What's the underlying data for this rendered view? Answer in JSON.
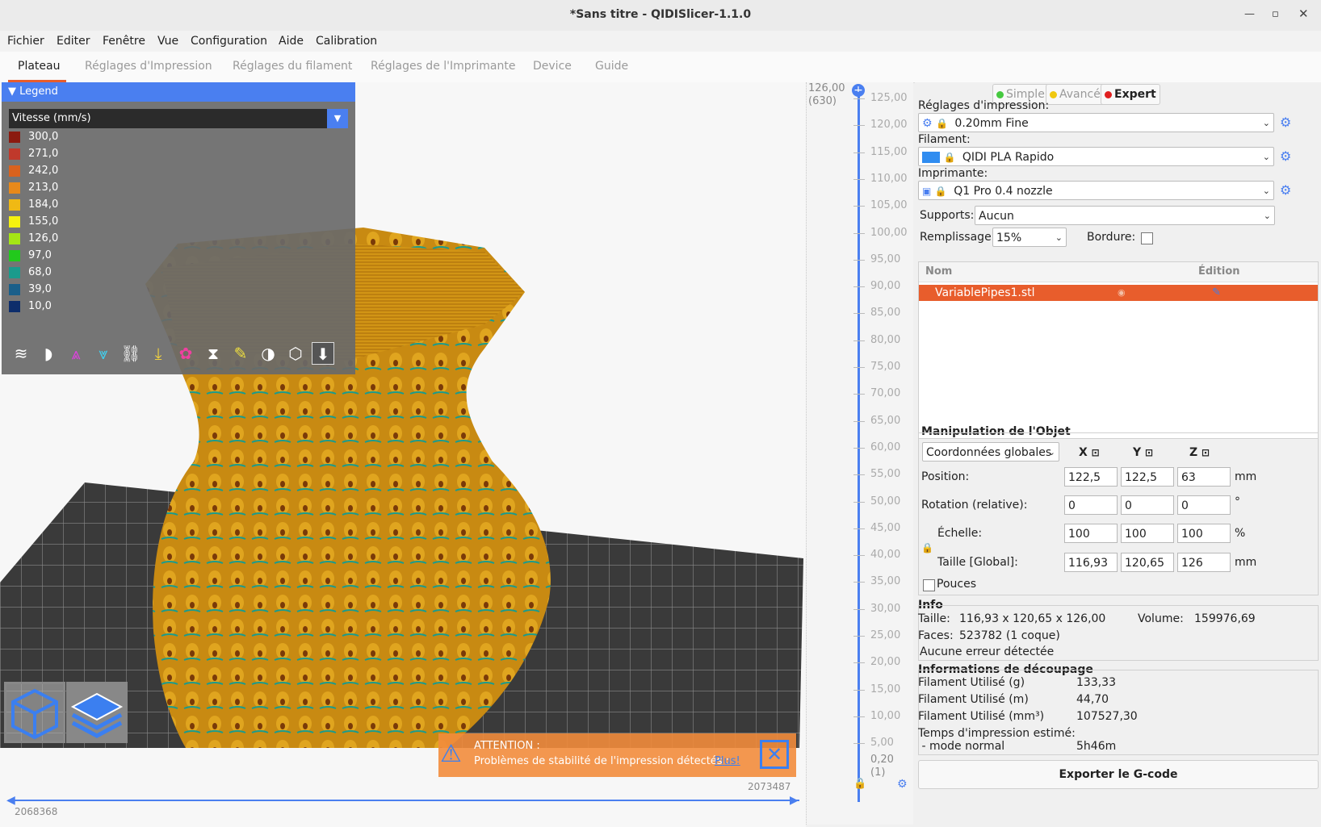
{
  "window": {
    "title": "*Sans titre - QIDISlicer-1.1.0"
  },
  "menu": [
    "Fichier",
    "Editer",
    "Fenêtre",
    "Vue",
    "Configuration",
    "Aide",
    "Calibration"
  ],
  "tabs": [
    "Plateau",
    "Réglages d'Impression",
    "Réglages du filament",
    "Réglages de l'Imprimante",
    "Device",
    "Guide"
  ],
  "legend": {
    "title": "Legend",
    "view_type": "Vitesse (mm/s)",
    "items": [
      {
        "value": "300,0",
        "color": "#8b1a0f"
      },
      {
        "value": "271,0",
        "color": "#c0392b"
      },
      {
        "value": "242,0",
        "color": "#d9621e"
      },
      {
        "value": "213,0",
        "color": "#e8891a"
      },
      {
        "value": "184,0",
        "color": "#f0b914"
      },
      {
        "value": "155,0",
        "color": "#f5f10f"
      },
      {
        "value": "126,0",
        "color": "#a5e615"
      },
      {
        "value": "97,0",
        "color": "#22c91c"
      },
      {
        "value": "68,0",
        "color": "#1a9b8c"
      },
      {
        "value": "39,0",
        "color": "#1a5f8a"
      },
      {
        "value": "10,0",
        "color": "#0d2d6b"
      }
    ]
  },
  "horizontal_slider": {
    "left": "2068368",
    "right": "2073487"
  },
  "warning": {
    "title": "ATTENTION :",
    "text": "Problèmes de stabilité de l'impression détectés :",
    "link": "Plus!"
  },
  "vertical_slider": {
    "top": "126,00",
    "top_sub": "(630)",
    "bottom": "0,20",
    "bottom_sub": "(1)",
    "ticks": [
      "125,00",
      "120,00",
      "115,00",
      "110,00",
      "105,00",
      "100,00",
      "95,00",
      "90,00",
      "85,00",
      "80,00",
      "75,00",
      "70,00",
      "65,00",
      "60,00",
      "55,00",
      "50,00",
      "45,00",
      "40,00",
      "35,00",
      "30,00",
      "25,00",
      "20,00",
      "15,00",
      "10,00",
      "5,00"
    ]
  },
  "modes": {
    "simple": "Simple",
    "advanced": "Avancé",
    "expert": "Expert",
    "colors": {
      "simple": "#46c940",
      "advanced": "#f0c810",
      "expert": "#e02020"
    }
  },
  "print_settings": {
    "label": "Réglages d'impression:",
    "value": "0.20mm Fine"
  },
  "filament": {
    "label": "Filament:",
    "value": "QIDI PLA Rapido",
    "color": "#2f8cf0"
  },
  "printer": {
    "label": "Imprimante:",
    "value": "Q1 Pro 0.4 nozzle"
  },
  "supports": {
    "label": "Supports:",
    "value": "Aucun"
  },
  "infill": {
    "label": "Remplissage:",
    "value": "15%"
  },
  "brim": {
    "label": "Bordure:"
  },
  "object_list": {
    "col_name": "Nom",
    "col_edit": "Édition",
    "objects": [
      "VariablePipes1.stl"
    ]
  },
  "manipulation": {
    "title": "Manipulation de l'Objet",
    "coords": "Coordonnées globales",
    "axes": [
      "X",
      "Y",
      "Z"
    ],
    "position": {
      "label": "Position:",
      "values": [
        "122,5",
        "122,5",
        "63"
      ],
      "unit": "mm"
    },
    "rotation": {
      "label": "Rotation (relative):",
      "values": [
        "0",
        "0",
        "0"
      ],
      "unit": "°"
    },
    "scale": {
      "label": "Échelle:",
      "values": [
        "100",
        "100",
        "100"
      ],
      "unit": "%"
    },
    "size": {
      "label": "Taille [Global]:",
      "values": [
        "116,93",
        "120,65",
        "126"
      ],
      "unit": "mm"
    },
    "inches": "Pouces"
  },
  "info": {
    "title": "Info",
    "size_label": "Taille:",
    "size_value": "116,93 x 120,65 x 126,00",
    "volume_label": "Volume:",
    "volume_value": "159976,69",
    "faces_label": "Faces:",
    "faces_value": "523782 (1 coque)",
    "errors": "Aucune erreur détectée"
  },
  "slice_info": {
    "title": "Informations de découpage",
    "rows": [
      {
        "label": "Filament Utilisé (g)",
        "value": "133,33"
      },
      {
        "label": "Filament Utilisé (m)",
        "value": "44,70"
      },
      {
        "label": "Filament Utilisé (mm³)",
        "value": "107527,30"
      }
    ],
    "time_label": "Temps d'impression estimé:",
    "mode_label": " - mode normal",
    "time_value": "5h46m"
  },
  "export_button": "Exporter le G-code"
}
